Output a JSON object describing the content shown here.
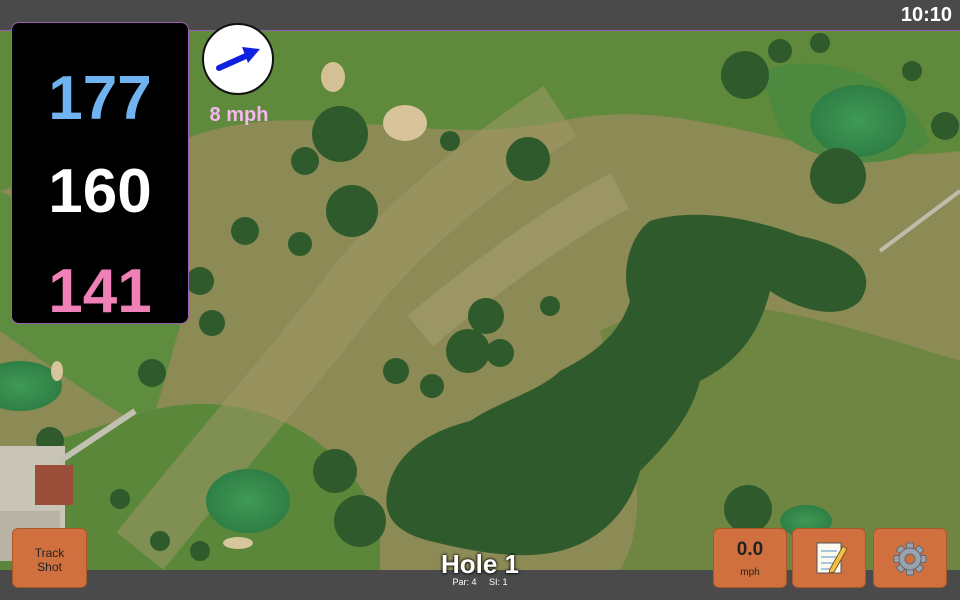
{
  "status_bar": {
    "time": "10:10"
  },
  "distances": {
    "back": "177",
    "middle": "160",
    "front": "141"
  },
  "wind": {
    "speed_label": "8 mph",
    "direction_icon": "arrow-up-right-icon",
    "arrow_color": "#1020e0"
  },
  "buttons": {
    "track_shot": "Track\nShot",
    "wind_value": "0.0",
    "wind_unit": "mph",
    "notes_icon": "notepad-icon",
    "settings_icon": "gear-icon"
  },
  "hole": {
    "title": "Hole 1",
    "par": "Par: 4",
    "si": "SI: 1"
  },
  "colors": {
    "button": "#d0703e",
    "back_distance": "#6fb4f0",
    "front_distance": "#f080b8",
    "wind_label": "#f6b7f2"
  }
}
